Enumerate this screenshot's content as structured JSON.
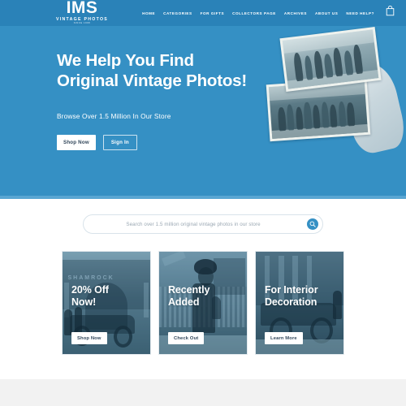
{
  "brand": {
    "logo_main": "IMS",
    "logo_sub": "VINTAGE PHOTOS",
    "logo_sub2": "SINCE 1998",
    "header_bg": "#2a82b8"
  },
  "nav": {
    "items": [
      {
        "label": "HOME"
      },
      {
        "label": "CATEGORIES"
      },
      {
        "label": "FOR GIFTS"
      },
      {
        "label": "COLLECTORS PAGE"
      },
      {
        "label": "ARCHIVES"
      },
      {
        "label": "ABOUT US"
      },
      {
        "label": "NEED HELP?"
      }
    ],
    "cart_icon": "shopping-bag-icon"
  },
  "hero": {
    "title_line1": "We Help You Find",
    "title_line2": "Original Vintage Photos!",
    "subtitle": "Browse Over 1.5 Million In Our Store",
    "primary_button": "Shop Now",
    "secondary_button": "Sign In",
    "bg": "#3590c4",
    "image_alt": "hand-holding-vintage-photos"
  },
  "search": {
    "placeholder": "Search over 1.5 million original vintage photos in our store",
    "value": "",
    "button_icon": "search-icon",
    "accent": "#3590c4"
  },
  "cards": [
    {
      "title_line1": "20% Off",
      "title_line2": "Now!",
      "button": "Shop Now",
      "image_alt": "shamrock-storefront-vintage-car",
      "sign_text": "SHAMROCK"
    },
    {
      "title_line1": "Recently",
      "title_line2": "Added",
      "button": "Check Out",
      "image_alt": "child-in-cap-portrait",
      "sign_text": ""
    },
    {
      "title_line1": "For Interior",
      "title_line2": "Decoration",
      "button": "Learn More",
      "image_alt": "vintage-car-in-front-of-building",
      "sign_text": ""
    }
  ],
  "footer": {
    "bg": "#f2f2f2"
  }
}
